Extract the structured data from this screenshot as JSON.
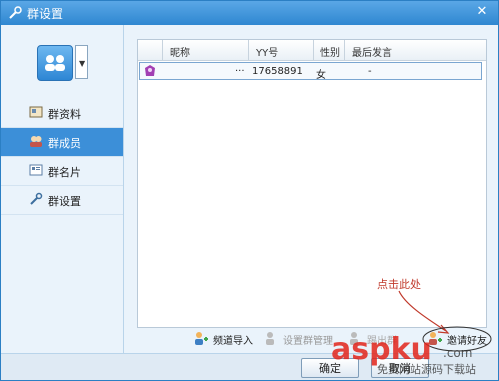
{
  "window": {
    "title": "群设置",
    "close_glyph": "✕"
  },
  "sidebar": {
    "items": [
      {
        "label": "群资料",
        "icon": "group-info-icon",
        "active": false
      },
      {
        "label": "群成员",
        "icon": "group-members-icon",
        "active": true
      },
      {
        "label": "群名片",
        "icon": "group-card-icon",
        "active": false
      },
      {
        "label": "群设置",
        "icon": "group-settings-icon",
        "active": false
      }
    ],
    "avatar_dropdown_glyph": "▼"
  },
  "members_table": {
    "columns": [
      "昵称",
      "YY号",
      "性别",
      "最后发言"
    ],
    "rows": [
      {
        "nickname": "···",
        "yy": "17658891",
        "gender": "女",
        "last_message": "-"
      }
    ]
  },
  "actions": {
    "import_channel": "频道导入",
    "set_admin": "设置群管理",
    "hidden": "踢出群",
    "invite_friend": "邀请好友"
  },
  "annotation": {
    "text": "点击此处",
    "color": "#c0392b"
  },
  "footer": {
    "ok": "确定",
    "cancel": "取消"
  },
  "watermark": {
    "brand": "aspku",
    "suffix": ".com",
    "caption": "免费网站源码下载站"
  },
  "colors": {
    "title_bar": "#2f87d1",
    "active_nav": "#3c8fd8",
    "annotation": "#c0392b"
  }
}
